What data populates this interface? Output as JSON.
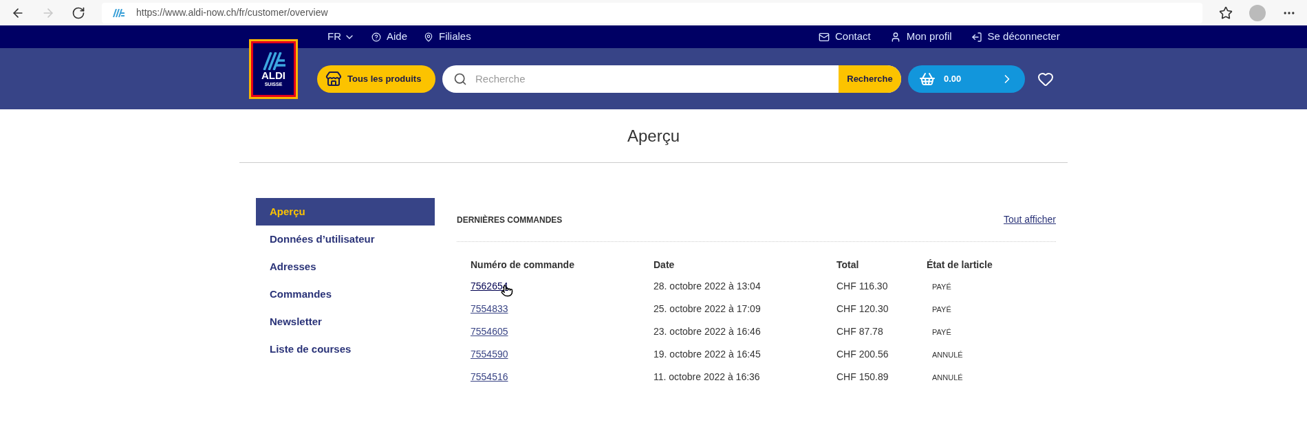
{
  "browser": {
    "url": "https://www.aldi-now.ch/fr/customer/overview",
    "forward_disabled": true
  },
  "top_nav": {
    "language": "FR",
    "left_links": [
      "Aide",
      "Filiales"
    ],
    "right_links": [
      "Contact",
      "Mon profil",
      "Se déconnecter"
    ]
  },
  "header": {
    "logo_text": "ALDI",
    "logo_subtext": "SUISSE",
    "products_button": "Tous les produits",
    "search": {
      "placeholder": "Recherche",
      "button": "Recherche"
    },
    "cart_total": "0.00"
  },
  "page_title": "Aperçu",
  "sidebar": {
    "items": [
      {
        "label": "Aperçu",
        "selected": true
      },
      {
        "label": "Données d’utilisateur",
        "selected": false
      },
      {
        "label": "Adresses",
        "selected": false
      },
      {
        "label": "Commandes",
        "selected": false
      },
      {
        "label": "Newsletter",
        "selected": false
      },
      {
        "label": "Liste de courses",
        "selected": false
      }
    ]
  },
  "orders": {
    "heading": "DERNIÈRES COMMANDES",
    "view_all": "Tout afficher",
    "columns": [
      "Numéro de commande",
      "Date",
      "Total",
      "État de larticle"
    ],
    "rows": [
      {
        "number": "7562654",
        "date": "28. octobre 2022 à 13:04",
        "total": "CHF 116.30",
        "status": "PAYÉ",
        "hovered": true
      },
      {
        "number": "7554833",
        "date": "25. octobre 2022 à 17:09",
        "total": "CHF 120.30",
        "status": "PAYÉ",
        "hovered": false
      },
      {
        "number": "7554605",
        "date": "23. octobre 2022 à 16:46",
        "total": "CHF 87.78",
        "status": "PAYÉ",
        "hovered": false
      },
      {
        "number": "7554590",
        "date": "19. octobre 2022 à 16:45",
        "total": "CHF 200.56",
        "status": "ANNULÉ",
        "hovered": false
      },
      {
        "number": "7554516",
        "date": "11. octobre 2022 à 16:36",
        "total": "CHF 150.89",
        "status": "ANNULÉ",
        "hovered": false
      }
    ]
  }
}
